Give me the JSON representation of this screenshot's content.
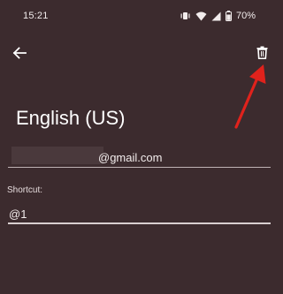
{
  "status_bar": {
    "time": "15:21",
    "battery": "70%",
    "icons": [
      "vibrate-icon",
      "wifi-icon",
      "signal-icon",
      "battery-icon"
    ]
  },
  "toolbar": {
    "back_icon": "back-arrow-icon",
    "delete_icon": "trash-icon"
  },
  "page": {
    "title": "English (US)"
  },
  "form": {
    "email_value": "@gmail.com",
    "shortcut_label": "Shortcut:",
    "shortcut_value": "@1"
  },
  "colors": {
    "background": "#3c2b2e",
    "annotation_arrow": "#e0221c"
  }
}
